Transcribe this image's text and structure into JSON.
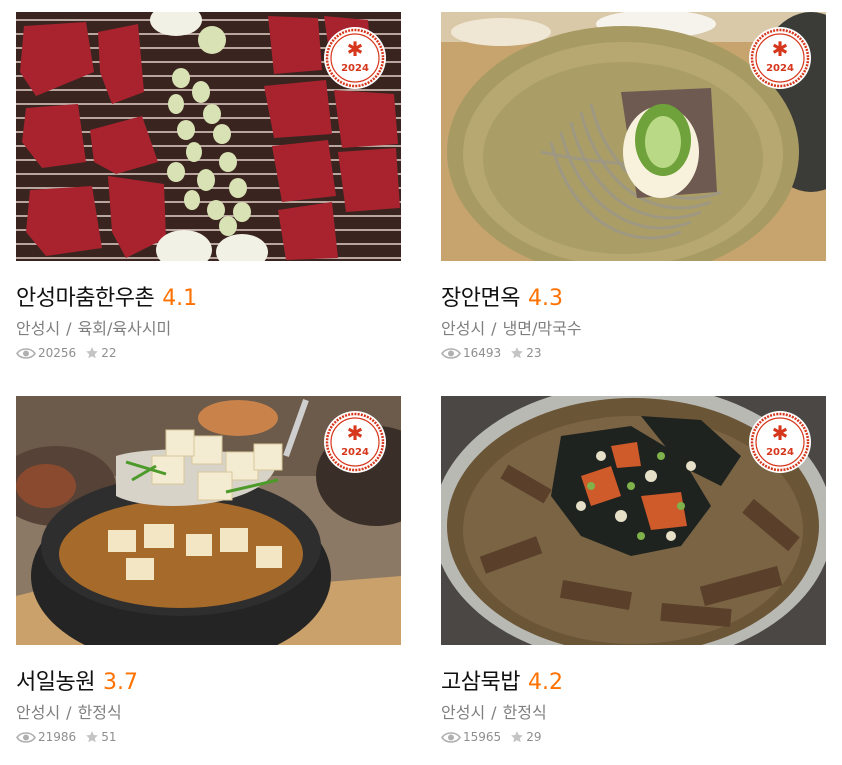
{
  "restaurants": [
    {
      "name": "안성마춤한우촌",
      "rating": "4.1",
      "region": "안성시",
      "category": "육회/육사시미",
      "views": "20256",
      "reviews": "22",
      "badge_year": "2024",
      "badge_color": "#d6361b",
      "photo": "korean-beef-bbq-with-garlic"
    },
    {
      "name": "장안면옥",
      "rating": "4.3",
      "region": "안성시",
      "category": "냉면/막국수",
      "views": "16493",
      "reviews": "23",
      "badge_year": "2024",
      "badge_color": "#d6361b",
      "photo": "cold-noodle-soup-bowl"
    },
    {
      "name": "서일농원",
      "rating": "3.7",
      "region": "안성시",
      "category": "한정식",
      "views": "21986",
      "reviews": "51",
      "badge_year": "2024",
      "badge_color": "#d6361b",
      "photo": "doenjang-stew-with-tofu"
    },
    {
      "name": "고삼묵밥",
      "rating": "4.2",
      "region": "안성시",
      "category": "한정식",
      "views": "15965",
      "reviews": "29",
      "badge_year": "2024",
      "badge_color": "#d6361b",
      "photo": "acorn-jelly-rice-soup"
    }
  ],
  "separator": "/",
  "colors": {
    "rating": "#ff7100",
    "meta": "#7f7f7f",
    "badge": "#d6361b"
  }
}
